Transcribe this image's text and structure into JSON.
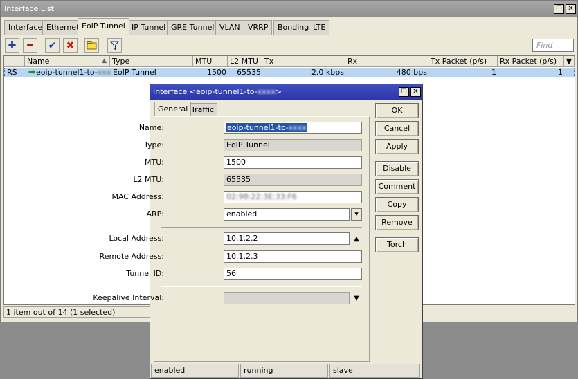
{
  "window": {
    "title": "Interface List",
    "controls": {
      "maximize": "☐",
      "close": "✕"
    },
    "tabs": [
      "Interface",
      "Ethernet",
      "EoIP Tunnel",
      "IP Tunnel",
      "GRE Tunnel",
      "VLAN",
      "VRRP",
      "Bonding",
      "LTE"
    ],
    "active_tab": "EoIP Tunnel",
    "toolbar": {
      "icons": [
        "plus-icon",
        "minus-icon",
        "check-icon",
        "x-icon",
        "comment-icon",
        "filter-icon"
      ],
      "find_placeholder": "Find"
    },
    "table": {
      "columns": [
        "",
        "Name",
        "Type",
        "MTU",
        "L2 MTU",
        "Tx",
        "Rx",
        "Tx Packet (p/s)",
        "Rx Packet (p/s)"
      ],
      "rows": [
        {
          "flags": "RS",
          "name": "eoip-tunnel1-to-",
          "name_hidden": "xxxx",
          "type": "EoIP Tunnel",
          "mtu": "1500",
          "l2mtu": "65535",
          "tx": "2.0 kbps",
          "rx": "480 bps",
          "txp": "1",
          "rxp": "1"
        }
      ]
    },
    "status": "1 item out of 14 (1 selected)",
    "colors": {
      "selection": "#b8d6f0",
      "dialog_title": "#2c36a8",
      "selected_text": "#2454a8"
    }
  },
  "dialog": {
    "title_prefix": "Interface <eoip-tunnel1-to-",
    "title_hidden": "xxxx",
    "title_suffix": ">",
    "tabs": [
      "General",
      "Traffic"
    ],
    "active_tab": "General",
    "fields": {
      "name": {
        "label": "Name:",
        "value": "eoip-tunnel1-to-",
        "hidden": "xxxx"
      },
      "type": {
        "label": "Type:",
        "value": "EoIP Tunnel"
      },
      "mtu": {
        "label": "MTU:",
        "value": "1500"
      },
      "l2mtu": {
        "label": "L2 MTU:",
        "value": "65535"
      },
      "mac": {
        "label": "MAC Address:",
        "value": "02:98:22:3E:33:F6"
      },
      "arp": {
        "label": "ARP:",
        "value": "enabled"
      },
      "local": {
        "label": "Local Address:",
        "value": "10.1.2.2"
      },
      "remote": {
        "label": "Remote Address:",
        "value": "10.1.2.3"
      },
      "tunnel_id": {
        "label": "Tunnel ID:",
        "value": "56"
      },
      "keepalive": {
        "label": "Keepalive Interval:",
        "value": ""
      }
    },
    "buttons": [
      "OK",
      "Cancel",
      "Apply",
      "Disable",
      "Comment",
      "Copy",
      "Remove",
      "Torch"
    ],
    "status": [
      "enabled",
      "running",
      "slave"
    ]
  }
}
